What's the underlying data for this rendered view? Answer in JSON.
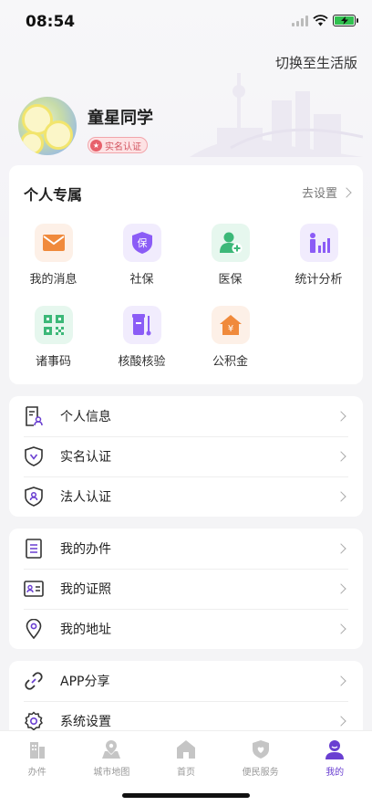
{
  "status_bar": {
    "time": "08:54"
  },
  "header": {
    "switch_label": "切换至生活版"
  },
  "profile": {
    "name": "童星同学",
    "verify_badge": "实名认证"
  },
  "exclusive": {
    "title": "个人专属",
    "more_label": "去设置",
    "items": [
      {
        "label": "我的消息",
        "icon": "mail-icon",
        "color": "#f08a3c",
        "bg": "#fdf0e7"
      },
      {
        "label": "社保",
        "icon": "social-security-icon",
        "color": "#8b5cf6",
        "bg": "#f1ecfd"
      },
      {
        "label": "医保",
        "icon": "medical-insurance-icon",
        "color": "#3cb878",
        "bg": "#e6f7ee"
      },
      {
        "label": "统计分析",
        "icon": "statistics-icon",
        "color": "#8b5cf6",
        "bg": "#f1ecfd"
      },
      {
        "label": "诸事码",
        "icon": "qr-code-icon",
        "color": "#3cb878",
        "bg": "#e6f7ee"
      },
      {
        "label": "核酸核验",
        "icon": "test-tube-icon",
        "color": "#8b5cf6",
        "bg": "#f1ecfd"
      },
      {
        "label": "公积金",
        "icon": "housing-fund-icon",
        "color": "#f08a3c",
        "bg": "#fdf0e7"
      }
    ]
  },
  "account_list": [
    {
      "label": "个人信息",
      "icon": "personal-info-icon"
    },
    {
      "label": "实名认证",
      "icon": "realname-shield-icon"
    },
    {
      "label": "法人认证",
      "icon": "legal-person-shield-icon"
    }
  ],
  "service_list": [
    {
      "label": "我的办件",
      "icon": "document-list-icon"
    },
    {
      "label": "我的证照",
      "icon": "id-card-icon"
    },
    {
      "label": "我的地址",
      "icon": "location-pin-icon"
    }
  ],
  "other_list": [
    {
      "label": "APP分享",
      "icon": "share-link-icon"
    },
    {
      "label": "系统设置",
      "icon": "gear-icon"
    }
  ],
  "tabs": [
    {
      "label": "办件",
      "icon": "building-icon",
      "active": false
    },
    {
      "label": "城市地图",
      "icon": "map-icon",
      "active": false
    },
    {
      "label": "首页",
      "icon": "home-icon",
      "active": false
    },
    {
      "label": "便民服务",
      "icon": "service-shield-icon",
      "active": false
    },
    {
      "label": "我的",
      "icon": "user-icon",
      "active": true
    }
  ],
  "colors": {
    "accent": "#6a3fd1",
    "inactive_tab": "#999999"
  }
}
